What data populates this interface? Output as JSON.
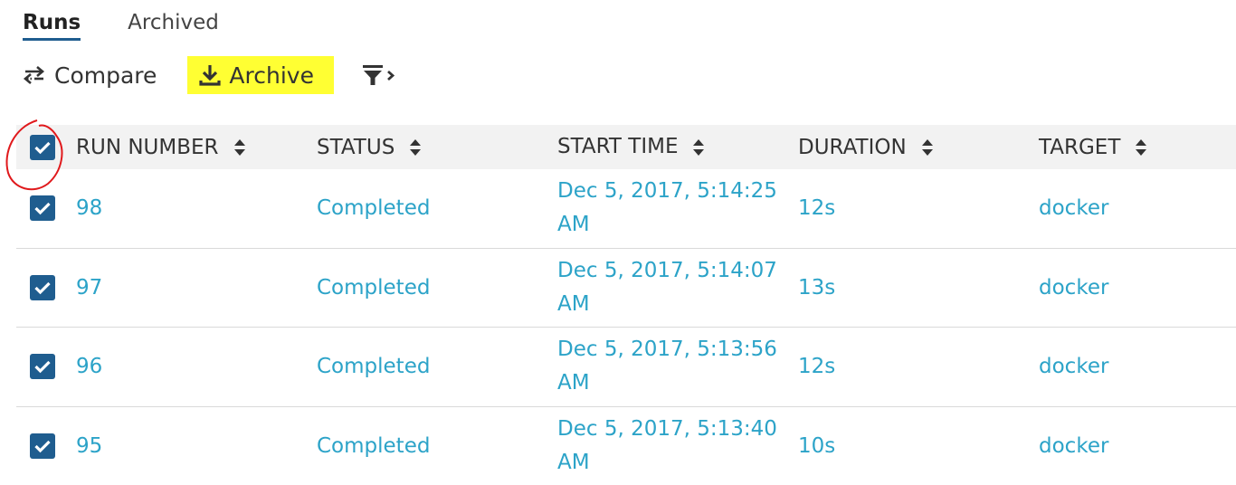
{
  "tabs": [
    {
      "label": "Runs",
      "active": true
    },
    {
      "label": "Archived",
      "active": false
    }
  ],
  "toolbar": {
    "compare_label": "Compare",
    "archive_label": "Archive"
  },
  "table": {
    "columns": [
      "RUN NUMBER",
      "STATUS",
      "START TIME",
      "DURATION",
      "TARGET"
    ],
    "select_all_checked": true,
    "rows": [
      {
        "checked": true,
        "run_number": "98",
        "status": "Completed",
        "start_time": "Dec 5, 2017, 5:14:25 AM",
        "duration": "12s",
        "target": "docker"
      },
      {
        "checked": true,
        "run_number": "97",
        "status": "Completed",
        "start_time": "Dec 5, 2017, 5:14:07 AM",
        "duration": "13s",
        "target": "docker"
      },
      {
        "checked": true,
        "run_number": "96",
        "status": "Completed",
        "start_time": "Dec 5, 2017, 5:13:56 AM",
        "duration": "12s",
        "target": "docker"
      },
      {
        "checked": true,
        "run_number": "95",
        "status": "Completed",
        "start_time": "Dec 5, 2017, 5:13:40 AM",
        "duration": "10s",
        "target": "docker"
      }
    ]
  },
  "icons": {
    "compare": "compare-arrows-icon",
    "archive": "download-icon",
    "filter": "filter-icon",
    "sort": "sort-icon",
    "checkbox": "checkmark-icon"
  },
  "colors": {
    "link": "#2ca3c8",
    "checkbox": "#1f5d8f",
    "highlight": "#ffff33",
    "annotation": "#e0191c",
    "header_bg": "#f2f2f2"
  }
}
